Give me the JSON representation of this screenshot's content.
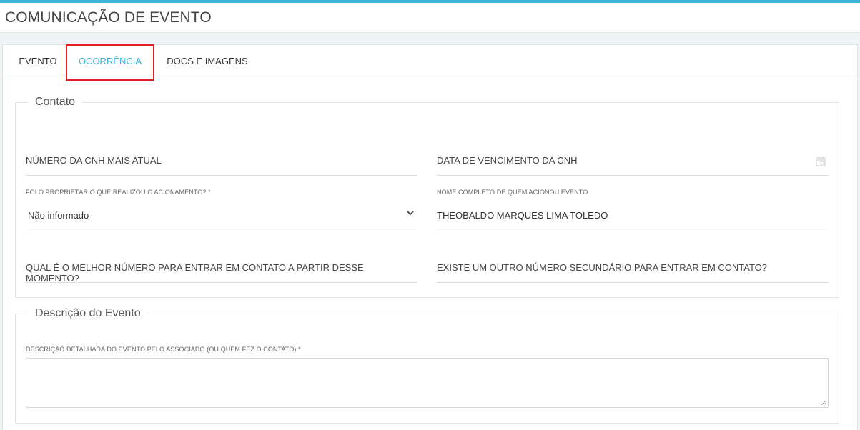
{
  "header": {
    "title": "COMUNICAÇÃO DE EVENTO",
    "accent_color": "#3cb4db"
  },
  "tabs": [
    {
      "label": "EVENTO",
      "active": false
    },
    {
      "label": "OCORRÊNCIA",
      "active": true,
      "highlighted": true
    },
    {
      "label": "DOCS E IMAGENS",
      "active": false
    }
  ],
  "contato": {
    "legend": "Contato",
    "cnh_numero": {
      "label": "NÚMERO DA CNH MAIS ATUAL",
      "value": ""
    },
    "cnh_vencimento": {
      "label": "DATA DE VENCIMENTO DA CNH",
      "value": "",
      "icon": "calendar-icon"
    },
    "proprietario": {
      "label": "FOI O PROPRIETÁRIO QUE REALIZOU O ACIONAMENTO? *",
      "value": "Não informado"
    },
    "nome_acionou": {
      "label": "NOME COMPLETO DE QUEM ACIONOU EVENTO",
      "value": "THEOBALDO MARQUES LIMA TOLEDO"
    },
    "melhor_numero": {
      "label": "QUAL É O MELHOR NÚMERO PARA ENTRAR EM CONTATO A PARTIR DESSE MOMENTO?",
      "value": ""
    },
    "numero_secundario": {
      "label": "EXISTE UM OUTRO NÚMERO SECUNDÁRIO PARA ENTRAR EM CONTATO?",
      "value": ""
    }
  },
  "descricao": {
    "legend": "Descrição do Evento",
    "detalhada": {
      "label": "DESCRIÇÃO DETALHADA DO EVENTO PELO ASSOCIADO (OU QUEM FEZ O CONTATO) *",
      "value": ""
    }
  }
}
